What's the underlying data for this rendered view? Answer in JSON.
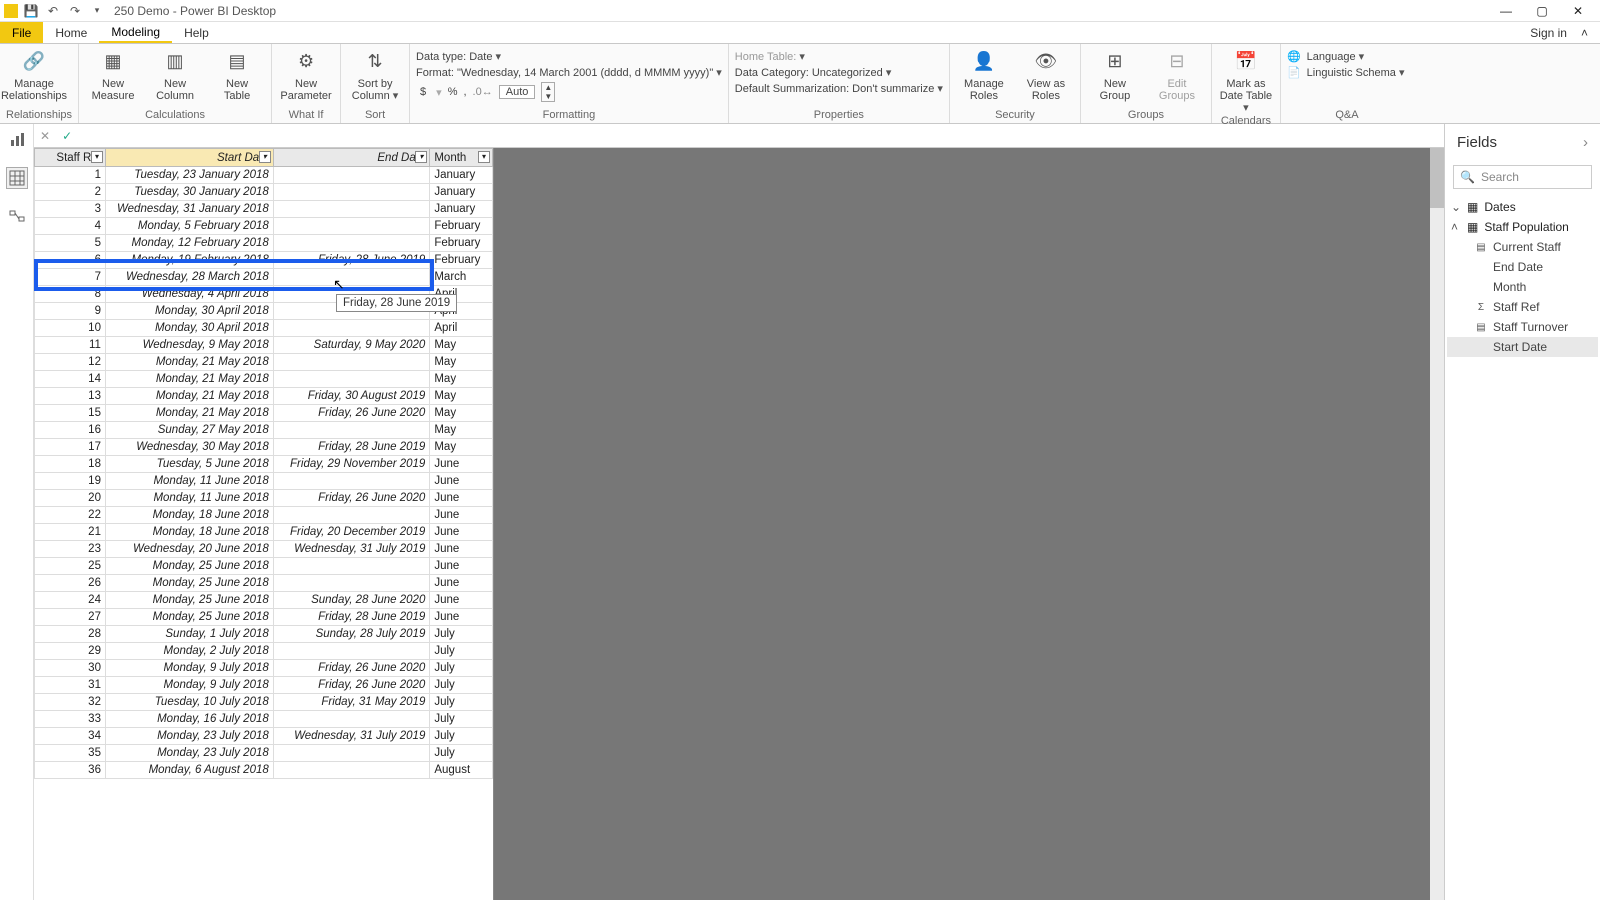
{
  "titlebar": {
    "title": "250 Demo - Power BI Desktop"
  },
  "ribbon_tabs": {
    "file": "File",
    "home": "Home",
    "modeling": "Modeling",
    "help": "Help",
    "signin": "Sign in"
  },
  "ribbon": {
    "relationships": {
      "manage": "Manage\nRelationships",
      "group": "Relationships"
    },
    "calculations": {
      "measure": "New\nMeasure",
      "column": "New\nColumn",
      "table": "New\nTable",
      "group": "Calculations"
    },
    "whatif": {
      "param": "New\nParameter",
      "group": "What If"
    },
    "sort": {
      "btn": "Sort by\nColumn",
      "group": "Sort"
    },
    "formatting": {
      "datatype_label": "Data type: Date",
      "format_label": "Format: \"Wednesday, 14 March 2001 (dddd, d MMMM yyyy)\"",
      "currency": "$",
      "percent": "%",
      "comma": ",",
      "decimals": "Auto",
      "group": "Formatting"
    },
    "properties": {
      "hometable": "Home Table:",
      "category": "Data Category: Uncategorized",
      "summarization": "Default Summarization: Don't summarize",
      "group": "Properties"
    },
    "security": {
      "manage": "Manage\nRoles",
      "viewas": "View as\nRoles",
      "group": "Security"
    },
    "groups": {
      "new": "New\nGroup",
      "edit": "Edit\nGroups",
      "group": "Groups"
    },
    "calendars": {
      "mark": "Mark as\nDate Table",
      "group": "Calendars"
    },
    "qa": {
      "lang": "Language",
      "schema": "Linguistic Schema",
      "group": "Q&A"
    }
  },
  "columns": {
    "staffref": "Staff Ref",
    "startdate": "Start Date",
    "enddate": "End Date",
    "month": "Month"
  },
  "highlight": {
    "staffref": "6",
    "start": "Monday, 19 February 2018",
    "end": "Friday, 28 June 2019",
    "month": "February",
    "tooltip": "Friday, 28 June 2019"
  },
  "rows": [
    {
      "r": "1",
      "s": "Tuesday, 23 January 2018",
      "e": "",
      "m": "January"
    },
    {
      "r": "2",
      "s": "Tuesday, 30 January 2018",
      "e": "",
      "m": "January"
    },
    {
      "r": "3",
      "s": "Wednesday, 31 January 2018",
      "e": "",
      "m": "January"
    },
    {
      "r": "4",
      "s": "Monday, 5 February 2018",
      "e": "",
      "m": "February"
    },
    {
      "r": "5",
      "s": "Monday, 12 February 2018",
      "e": "",
      "m": "February"
    },
    {
      "r": "6",
      "s": "Monday, 19 February 2018",
      "e": "Friday, 28 June 2019",
      "m": "February"
    },
    {
      "r": "7",
      "s": "Wednesday, 28 March 2018",
      "e": "",
      "m": "March"
    },
    {
      "r": "8",
      "s": "Wednesday, 4 April 2018",
      "e": "",
      "m": "April"
    },
    {
      "r": "9",
      "s": "Monday, 30 April 2018",
      "e": "",
      "m": "April"
    },
    {
      "r": "10",
      "s": "Monday, 30 April 2018",
      "e": "",
      "m": "April"
    },
    {
      "r": "11",
      "s": "Wednesday, 9 May 2018",
      "e": "Saturday, 9 May 2020",
      "m": "May"
    },
    {
      "r": "12",
      "s": "Monday, 21 May 2018",
      "e": "",
      "m": "May"
    },
    {
      "r": "14",
      "s": "Monday, 21 May 2018",
      "e": "",
      "m": "May"
    },
    {
      "r": "13",
      "s": "Monday, 21 May 2018",
      "e": "Friday, 30 August 2019",
      "m": "May"
    },
    {
      "r": "15",
      "s": "Monday, 21 May 2018",
      "e": "Friday, 26 June 2020",
      "m": "May"
    },
    {
      "r": "16",
      "s": "Sunday, 27 May 2018",
      "e": "",
      "m": "May"
    },
    {
      "r": "17",
      "s": "Wednesday, 30 May 2018",
      "e": "Friday, 28 June 2019",
      "m": "May"
    },
    {
      "r": "18",
      "s": "Tuesday, 5 June 2018",
      "e": "Friday, 29 November 2019",
      "m": "June"
    },
    {
      "r": "19",
      "s": "Monday, 11 June 2018",
      "e": "",
      "m": "June"
    },
    {
      "r": "20",
      "s": "Monday, 11 June 2018",
      "e": "Friday, 26 June 2020",
      "m": "June"
    },
    {
      "r": "22",
      "s": "Monday, 18 June 2018",
      "e": "",
      "m": "June"
    },
    {
      "r": "21",
      "s": "Monday, 18 June 2018",
      "e": "Friday, 20 December 2019",
      "m": "June"
    },
    {
      "r": "23",
      "s": "Wednesday, 20 June 2018",
      "e": "Wednesday, 31 July 2019",
      "m": "June"
    },
    {
      "r": "25",
      "s": "Monday, 25 June 2018",
      "e": "",
      "m": "June"
    },
    {
      "r": "26",
      "s": "Monday, 25 June 2018",
      "e": "",
      "m": "June"
    },
    {
      "r": "24",
      "s": "Monday, 25 June 2018",
      "e": "Sunday, 28 June 2020",
      "m": "June"
    },
    {
      "r": "27",
      "s": "Monday, 25 June 2018",
      "e": "Friday, 28 June 2019",
      "m": "June"
    },
    {
      "r": "28",
      "s": "Sunday, 1 July 2018",
      "e": "Sunday, 28 July 2019",
      "m": "July"
    },
    {
      "r": "29",
      "s": "Monday, 2 July 2018",
      "e": "",
      "m": "July"
    },
    {
      "r": "30",
      "s": "Monday, 9 July 2018",
      "e": "Friday, 26 June 2020",
      "m": "July"
    },
    {
      "r": "31",
      "s": "Monday, 9 July 2018",
      "e": "Friday, 26 June 2020",
      "m": "July"
    },
    {
      "r": "32",
      "s": "Tuesday, 10 July 2018",
      "e": "Friday, 31 May 2019",
      "m": "July"
    },
    {
      "r": "33",
      "s": "Monday, 16 July 2018",
      "e": "",
      "m": "July"
    },
    {
      "r": "34",
      "s": "Monday, 23 July 2018",
      "e": "Wednesday, 31 July 2019",
      "m": "July"
    },
    {
      "r": "35",
      "s": "Monday, 23 July 2018",
      "e": "",
      "m": "July"
    },
    {
      "r": "36",
      "s": "Monday, 6 August 2018",
      "e": "",
      "m": "August"
    }
  ],
  "fields": {
    "title": "Fields",
    "search": "Search",
    "tables": {
      "dates": "Dates",
      "staffpop": "Staff Population"
    },
    "items": {
      "current": "Current Staff",
      "enddate": "End Date",
      "month": "Month",
      "staffref": "Staff Ref",
      "turnover": "Staff Turnover",
      "startdate": "Start Date"
    }
  }
}
